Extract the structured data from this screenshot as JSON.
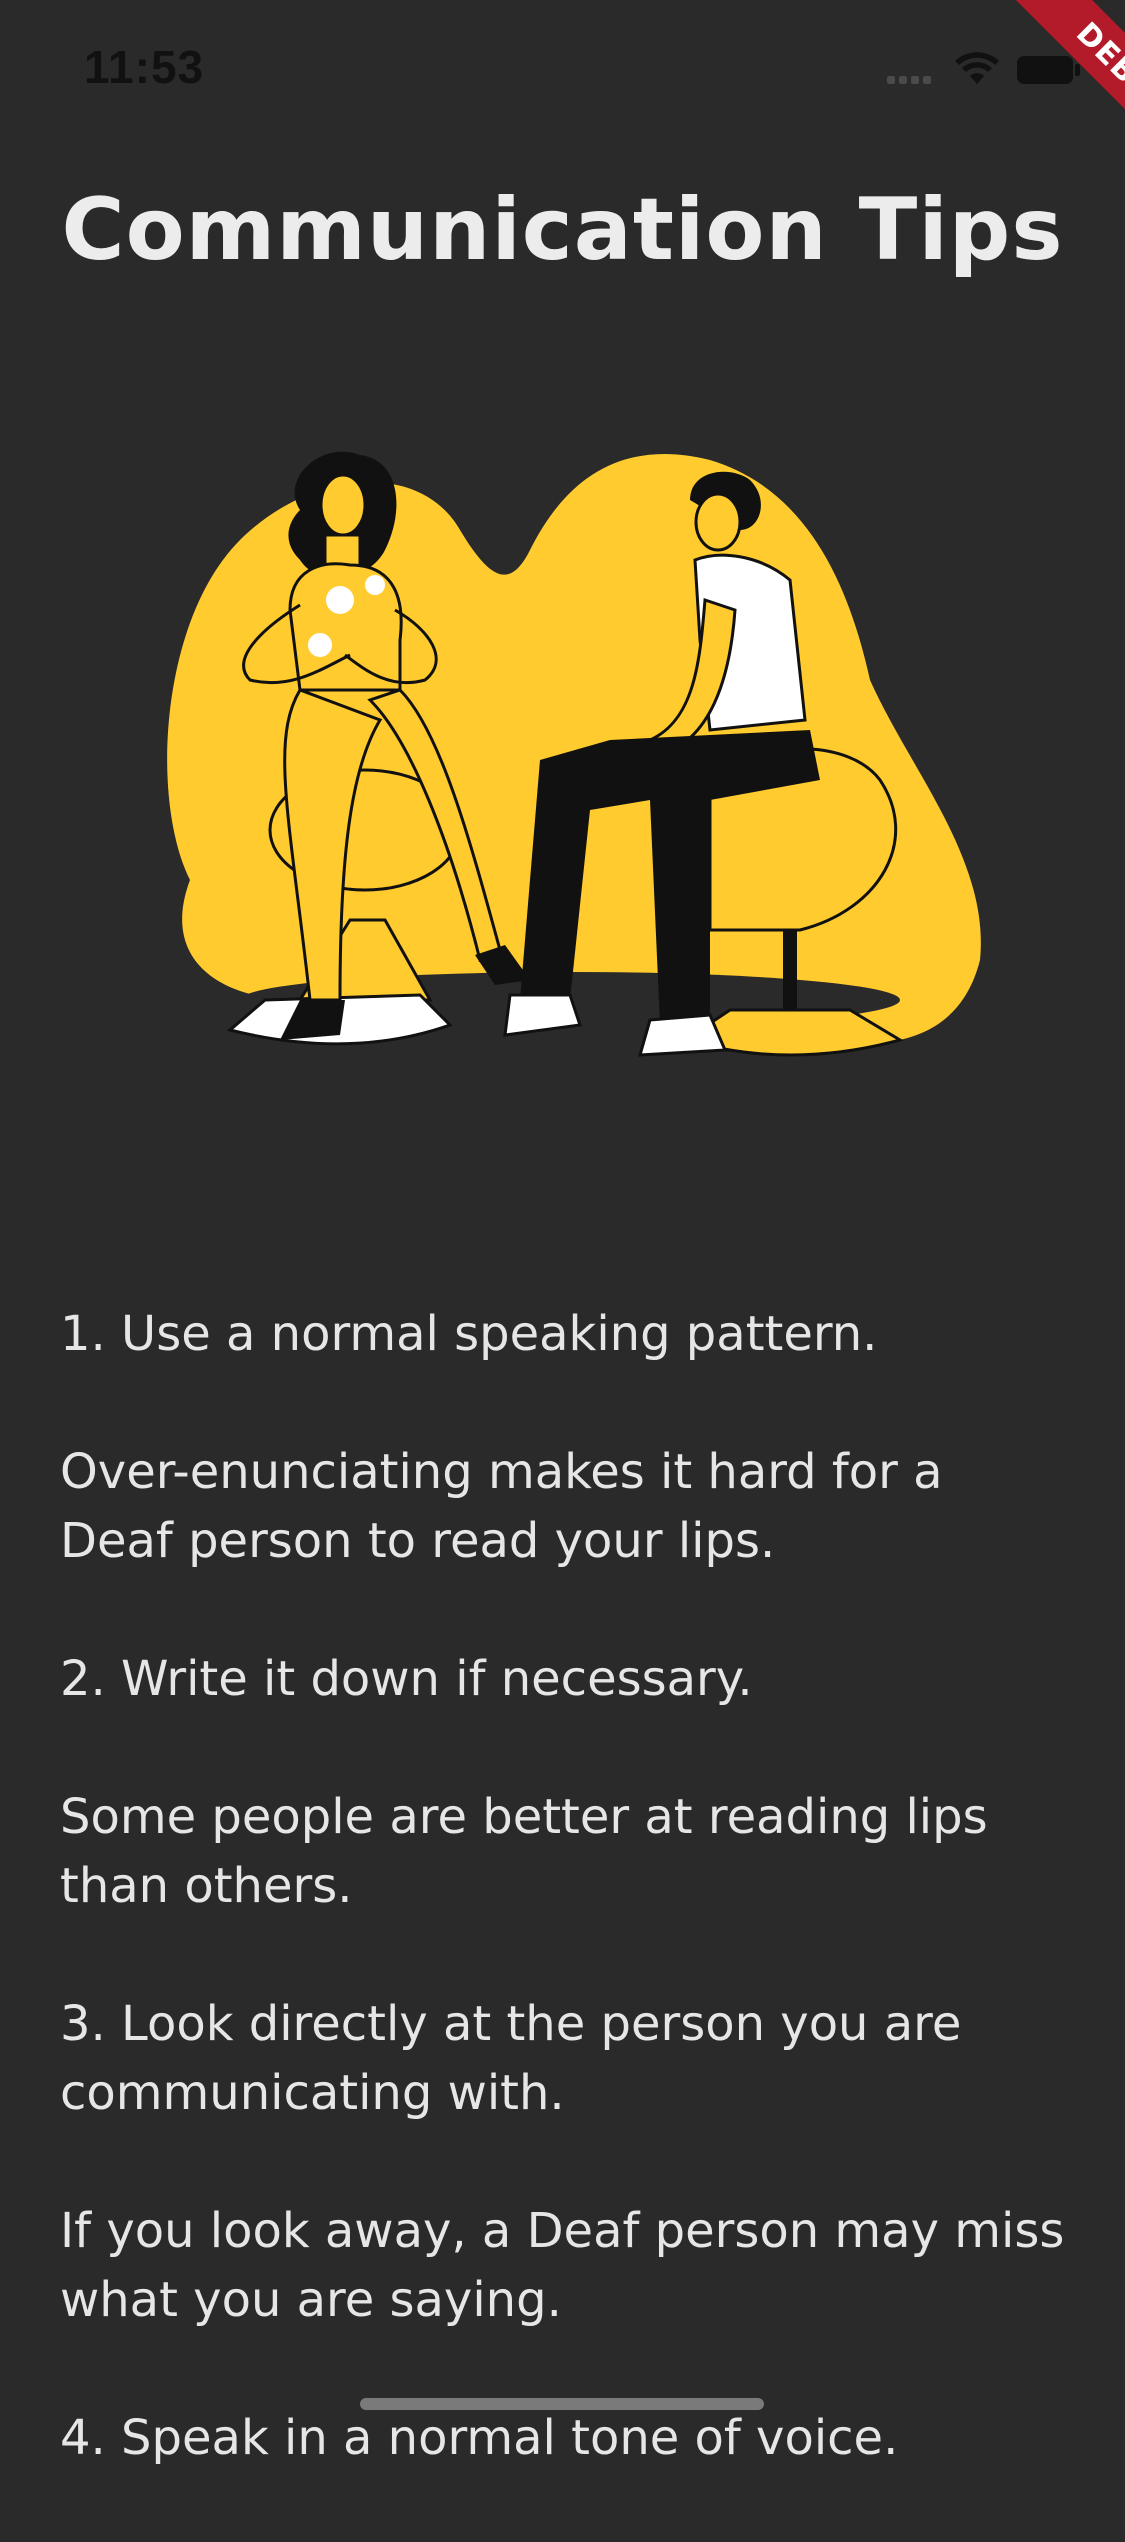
{
  "status_bar": {
    "time": "11:53",
    "icons": [
      "signal-icon",
      "wifi-icon",
      "battery-icon"
    ]
  },
  "debug_banner": {
    "label": "DEBUG",
    "color": "#b31b2a"
  },
  "page": {
    "title": "Communication Tips",
    "background": "#2a2a2a",
    "accent": "#ffcb2f"
  },
  "illustration": {
    "name": "two-people-conversation-illustration"
  },
  "tips": [
    {
      "heading": "1. Use a normal speaking pattern.",
      "body": "Over-enunciating makes it hard for a Deaf person to read your lips."
    },
    {
      "heading": "2. Write it down if necessary.",
      "body": "Some people are better at reading lips than others."
    },
    {
      "heading": "3. Look directly at the person you are communicating with.",
      "body": "If you look away, a Deaf person may miss what you are saying."
    },
    {
      "heading": "4. Speak in a normal tone of voice.",
      "body": ""
    }
  ]
}
